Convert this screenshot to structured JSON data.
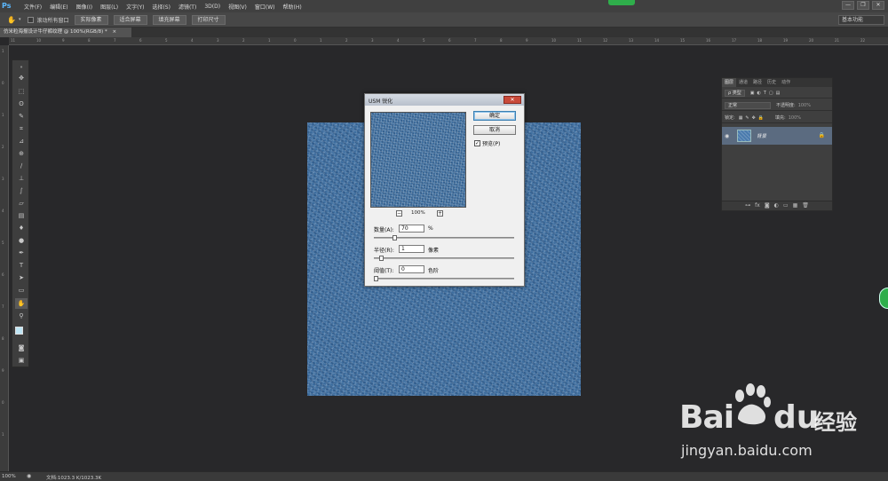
{
  "menubar": {
    "logo": "Ps",
    "items": [
      "文件(F)",
      "编辑(E)",
      "图像(I)",
      "图层(L)",
      "文字(Y)",
      "选择(S)",
      "滤镜(T)",
      "3D(D)",
      "视图(V)",
      "窗口(W)",
      "帮助(H)"
    ],
    "window_controls": [
      "—",
      "❐",
      "✕"
    ]
  },
  "options": {
    "scroll_all_label": "滚动所有窗口",
    "buttons": [
      "实际像素",
      "适合屏幕",
      "填充屏幕",
      "打印尺寸"
    ],
    "workspace": "基本功能"
  },
  "document": {
    "tab_label": "仿米粒海报设计牛仔裤纹理 @ 100%(RGB/8) *",
    "tab_close": "×"
  },
  "ruler_top_ticks": [
    "11",
    "10",
    "9",
    "8",
    "7",
    "6",
    "5",
    "4",
    "3",
    "2",
    "1",
    "0",
    "1",
    "2",
    "3",
    "4",
    "5",
    "6",
    "7",
    "8",
    "9",
    "10",
    "11",
    "12",
    "13",
    "14",
    "15",
    "16",
    "17",
    "18",
    "19",
    "20",
    "21",
    "22"
  ],
  "ruler_left_ticks": [
    "1",
    "0",
    "1",
    "2",
    "3",
    "4",
    "5",
    "6",
    "7",
    "8",
    "9",
    "0",
    "1"
  ],
  "dialog": {
    "title": "USM 锐化",
    "close": "✕",
    "ok_label": "确定",
    "cancel_label": "取消",
    "preview_label": "预览(P)",
    "preview_checked": true,
    "zoom_minus": "−",
    "zoom_plus": "+",
    "zoom_value": "100%",
    "amount": {
      "label": "数量(A):",
      "value": "70",
      "unit": "%",
      "slider_fraction": 0.14
    },
    "radius": {
      "label": "半径(R):",
      "value": "1",
      "unit": "像素",
      "slider_fraction": 0.04
    },
    "threshold": {
      "label": "阈值(T):",
      "value": "0",
      "unit": "色阶",
      "slider_fraction": 0.0
    }
  },
  "layers_panel": {
    "tabs": [
      "图层",
      "通道",
      "路径",
      "历史",
      "动作"
    ],
    "filter_kind": "ρ 类型",
    "blend_mode": "正常",
    "opacity_label": "不透明度:",
    "opacity_value": "100%",
    "lock_label": "锁定:",
    "fill_label": "填充:",
    "fill_value": "100%",
    "layer_name": "背景",
    "bottom_icons": [
      "⊶",
      "fx",
      "◙",
      "◐",
      "▭",
      "▦",
      "🗑"
    ]
  },
  "status": {
    "zoom": "100%",
    "doc": "文档:1023.3 K/1023.3K"
  },
  "watermark": {
    "bai": "Bai",
    "du": "du",
    "jingyan": "经验",
    "url": "jingyan.baidu.com"
  },
  "colors": {
    "accent": "#5bb8ff",
    "denim": "#3d6d9e",
    "selected_layer": "#5b6b80"
  }
}
